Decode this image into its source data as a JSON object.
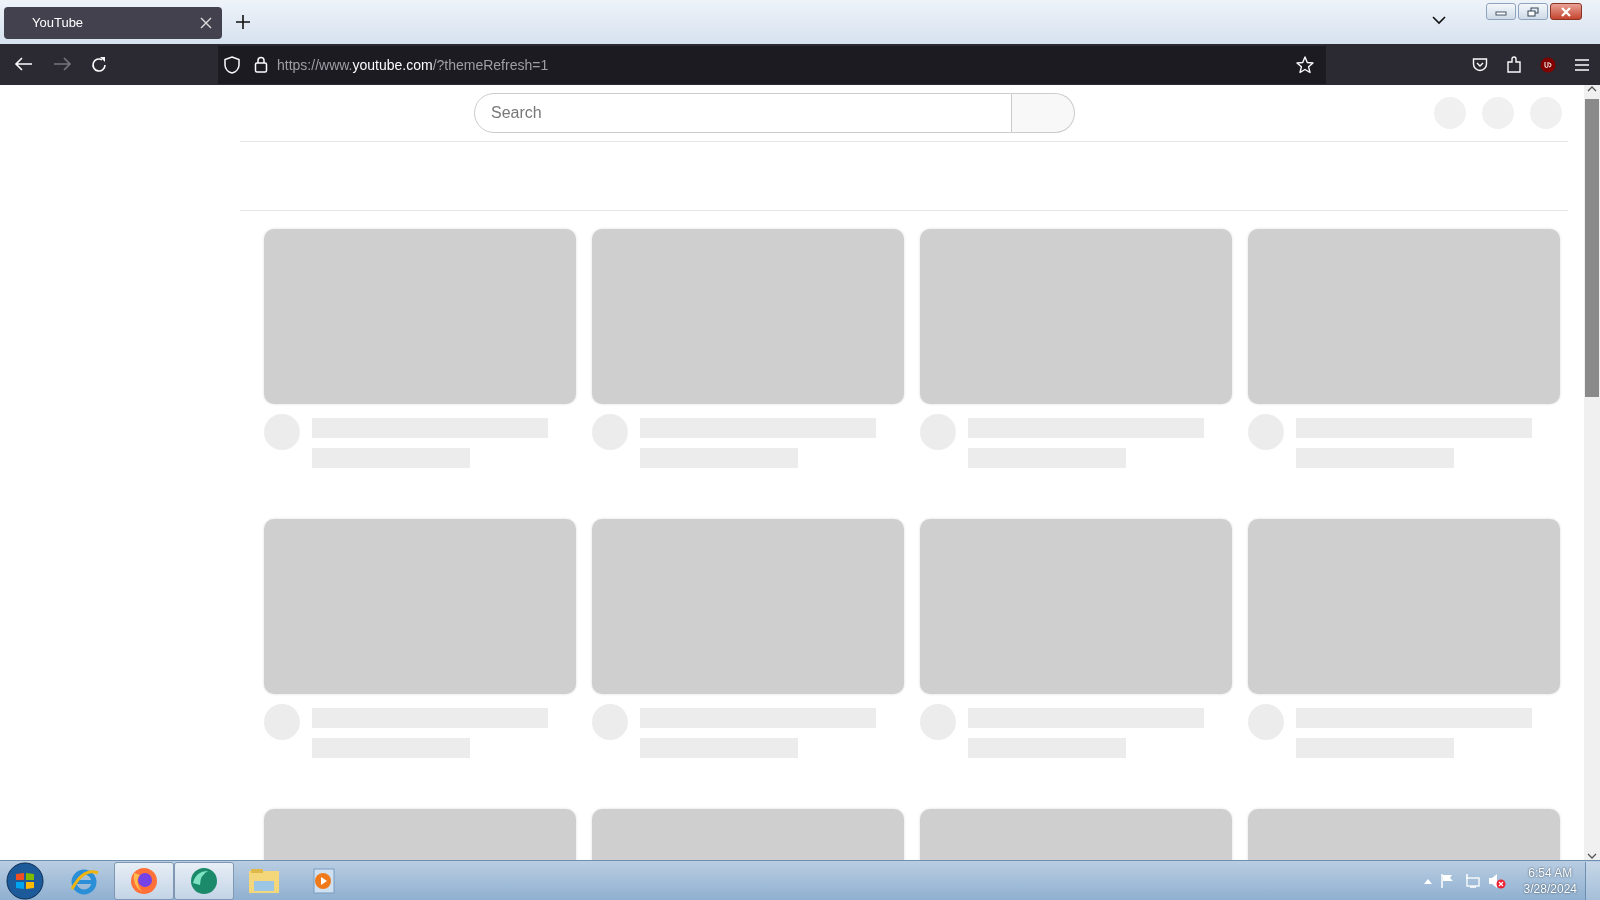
{
  "browser": {
    "tab": {
      "title": "YouTube",
      "selected": true
    },
    "url": {
      "prefix": "https://www.",
      "host": "youtube.com",
      "suffix": "/?themeRefresh=1"
    }
  },
  "page": {
    "search": {
      "placeholder": "Search"
    },
    "video_cards": [
      {
        "kind": "skeleton"
      },
      {
        "kind": "skeleton"
      },
      {
        "kind": "skeleton"
      },
      {
        "kind": "skeleton"
      },
      {
        "kind": "skeleton"
      },
      {
        "kind": "skeleton"
      },
      {
        "kind": "skeleton"
      },
      {
        "kind": "skeleton"
      },
      {
        "kind": "thumb_only"
      },
      {
        "kind": "thumb_only"
      },
      {
        "kind": "thumb_only"
      },
      {
        "kind": "thumb_only"
      }
    ]
  },
  "taskbar": {
    "items": [
      {
        "kind": "ie",
        "running": false
      },
      {
        "kind": "firefox",
        "running": true
      },
      {
        "kind": "chat",
        "running": true
      },
      {
        "kind": "folder",
        "running": false
      },
      {
        "kind": "media",
        "running": false
      }
    ],
    "clock": {
      "time": "6:54 AM",
      "date": "3/28/2024"
    }
  }
}
